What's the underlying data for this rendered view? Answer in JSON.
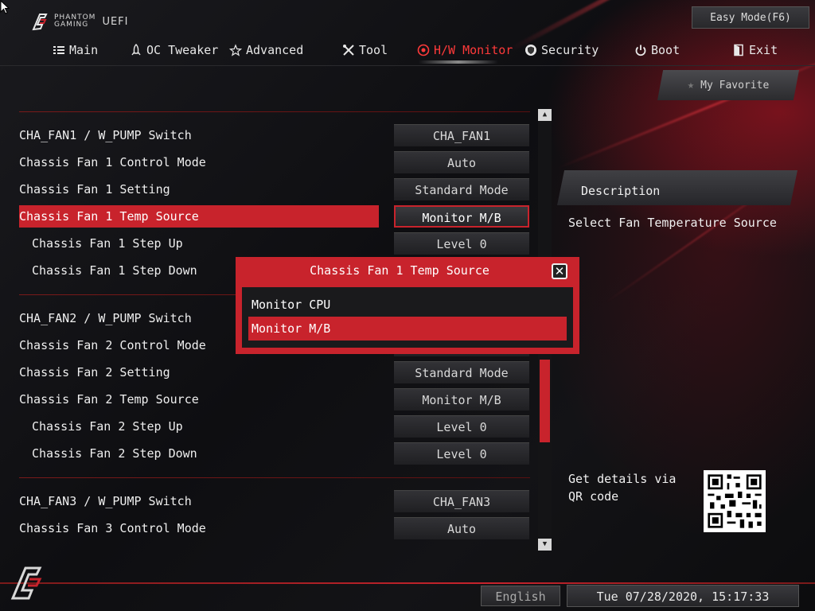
{
  "brand": {
    "line1": "PHANTOM",
    "line2": "GAMING",
    "uefi": "UEFI"
  },
  "header": {
    "easy_mode": "Easy Mode(F6)"
  },
  "nav": {
    "main": "Main",
    "oc_tweaker": "OC Tweaker",
    "advanced": "Advanced",
    "tool": "Tool",
    "hw_monitor": "H/W Monitor",
    "security": "Security",
    "boot": "Boot",
    "exit": "Exit"
  },
  "favorite": {
    "label": "My Favorite"
  },
  "settings": [
    {
      "label": "CHA_FAN1 / W_PUMP Switch",
      "value": "CHA_FAN1"
    },
    {
      "label": "Chassis Fan 1 Control Mode",
      "value": "Auto"
    },
    {
      "label": "Chassis Fan 1 Setting",
      "value": "Standard Mode"
    },
    {
      "label": "Chassis Fan 1 Temp Source",
      "value": "Monitor M/B"
    },
    {
      "label": "Chassis Fan 1 Step Up",
      "value": "Level 0"
    },
    {
      "label": "Chassis Fan 1 Step Down",
      "value": ""
    },
    {
      "label": "CHA_FAN2 / W_PUMP Switch",
      "value": ""
    },
    {
      "label": "Chassis Fan 2 Control Mode",
      "value": ""
    },
    {
      "label": "Chassis Fan 2 Setting",
      "value": "Standard Mode"
    },
    {
      "label": "Chassis Fan 2 Temp Source",
      "value": "Monitor M/B"
    },
    {
      "label": "Chassis Fan 2 Step Up",
      "value": "Level 0"
    },
    {
      "label": "Chassis Fan 2 Step Down",
      "value": "Level 0"
    },
    {
      "label": "CHA_FAN3 / W_PUMP Switch",
      "value": "CHA_FAN3"
    },
    {
      "label": "Chassis Fan 3 Control Mode",
      "value": "Auto"
    }
  ],
  "description": {
    "title": "Description",
    "text": "Select Fan Temperature Source",
    "qr_text": "Get details via QR code"
  },
  "popup": {
    "title": "Chassis Fan 1 Temp Source",
    "close": "✕",
    "options": [
      "Monitor CPU",
      "Monitor M/B"
    ]
  },
  "footer": {
    "language": "English",
    "datetime": "Tue 07/28/2020, 15:17:33"
  },
  "colors": {
    "accent": "#c8232c",
    "background": "#0b0b0d"
  }
}
